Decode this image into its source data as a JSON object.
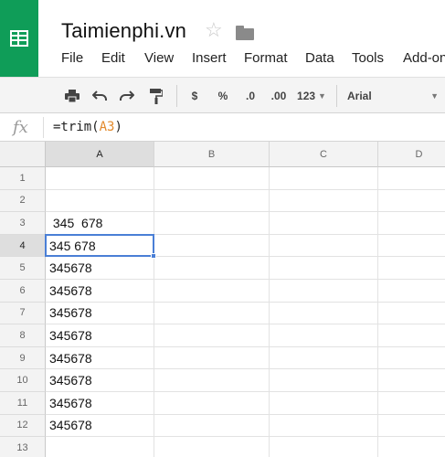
{
  "app": {
    "title": "Taimienphi.vn",
    "accent_color": "#0f9d58",
    "logo_icon": "sheets-grid-icon"
  },
  "menu": [
    "File",
    "Edit",
    "View",
    "Insert",
    "Format",
    "Data",
    "Tools",
    "Add-on"
  ],
  "toolbar": {
    "currency": "$",
    "percent": "%",
    "decrease_decimal": ".0",
    "increase_decimal": ".00",
    "more_formats": "123",
    "font": "Arial"
  },
  "formula_bar": {
    "fx_label": "fx",
    "prefix": "=trim(",
    "ref": "A3",
    "suffix": ")"
  },
  "sheet": {
    "columns": [
      "A",
      "B",
      "C",
      "D"
    ],
    "active_column": "A",
    "active_row": "4",
    "selected_cell": "A4",
    "rows": [
      {
        "num": "1",
        "a": ""
      },
      {
        "num": "2",
        "a": ""
      },
      {
        "num": "3",
        "a": " 345  678"
      },
      {
        "num": "4",
        "a": "345 678"
      },
      {
        "num": "5",
        "a": "345678"
      },
      {
        "num": "6",
        "a": "345678"
      },
      {
        "num": "7",
        "a": "345678"
      },
      {
        "num": "8",
        "a": "345678"
      },
      {
        "num": "9",
        "a": "345678"
      },
      {
        "num": "10",
        "a": "345678"
      },
      {
        "num": "11",
        "a": "345678"
      },
      {
        "num": "12",
        "a": "345678"
      },
      {
        "num": "13",
        "a": ""
      }
    ]
  }
}
